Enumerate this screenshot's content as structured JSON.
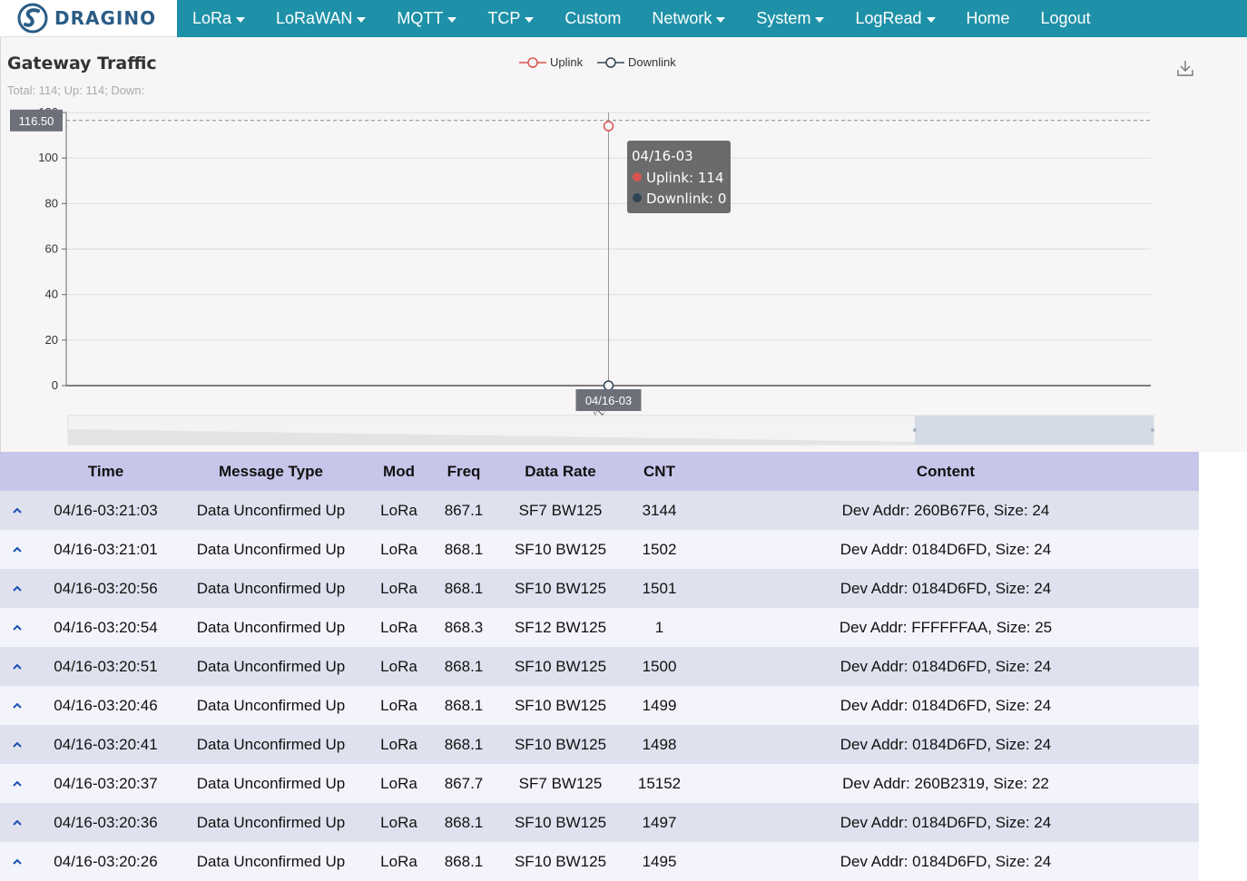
{
  "nav": {
    "brand": "DRAGINO",
    "items": [
      {
        "label": "LoRa",
        "dropdown": true
      },
      {
        "label": "LoRaWAN",
        "dropdown": true
      },
      {
        "label": "MQTT",
        "dropdown": true
      },
      {
        "label": "TCP",
        "dropdown": true
      },
      {
        "label": "Custom",
        "dropdown": false
      },
      {
        "label": "Network",
        "dropdown": true
      },
      {
        "label": "System",
        "dropdown": true
      },
      {
        "label": "LogRead",
        "dropdown": true
      },
      {
        "label": "Home",
        "dropdown": false
      },
      {
        "label": "Logout",
        "dropdown": false
      }
    ]
  },
  "traffic": {
    "title": "Gateway Traffic",
    "summary": "Total: 114; Up: 114; Down:",
    "legend": {
      "uplink": "Uplink",
      "downlink": "Downlink"
    },
    "icons": {
      "download": "download-icon"
    }
  },
  "chart_data": {
    "type": "line",
    "categories": [
      "04/16-03"
    ],
    "series": [
      {
        "name": "Uplink",
        "values": [
          114
        ],
        "color": "#d9534f"
      },
      {
        "name": "Downlink",
        "values": [
          0
        ],
        "color": "#2f4554"
      }
    ],
    "ylim": [
      0,
      120
    ],
    "yticks": [
      0,
      20,
      40,
      60,
      80,
      100,
      120
    ],
    "grid": true,
    "legend": "top-center",
    "crosshair_y_label": "116.50",
    "crosshair_x_label": "04/16-03",
    "tooltip": {
      "title": "04/16-03",
      "uplink": "Uplink: 114",
      "downlink": "Downlink: 0"
    },
    "rotated_x_label": "04/16-03"
  },
  "table": {
    "headers": [
      "Time",
      "Message Type",
      "Mod",
      "Freq",
      "Data Rate",
      "CNT",
      "Content"
    ],
    "rows": [
      [
        "04/16-03:21:03",
        "Data Unconfirmed Up",
        "LoRa",
        "867.1",
        "SF7 BW125",
        "3144",
        "Dev Addr: 260B67F6, Size: 24"
      ],
      [
        "04/16-03:21:01",
        "Data Unconfirmed Up",
        "LoRa",
        "868.1",
        "SF10 BW125",
        "1502",
        "Dev Addr: 0184D6FD, Size: 24"
      ],
      [
        "04/16-03:20:56",
        "Data Unconfirmed Up",
        "LoRa",
        "868.1",
        "SF10 BW125",
        "1501",
        "Dev Addr: 0184D6FD, Size: 24"
      ],
      [
        "04/16-03:20:54",
        "Data Unconfirmed Up",
        "LoRa",
        "868.3",
        "SF12 BW125",
        "1",
        "Dev Addr: FFFFFFAA, Size: 25"
      ],
      [
        "04/16-03:20:51",
        "Data Unconfirmed Up",
        "LoRa",
        "868.1",
        "SF10 BW125",
        "1500",
        "Dev Addr: 0184D6FD, Size: 24"
      ],
      [
        "04/16-03:20:46",
        "Data Unconfirmed Up",
        "LoRa",
        "868.1",
        "SF10 BW125",
        "1499",
        "Dev Addr: 0184D6FD, Size: 24"
      ],
      [
        "04/16-03:20:41",
        "Data Unconfirmed Up",
        "LoRa",
        "868.1",
        "SF10 BW125",
        "1498",
        "Dev Addr: 0184D6FD, Size: 24"
      ],
      [
        "04/16-03:20:37",
        "Data Unconfirmed Up",
        "LoRa",
        "867.7",
        "SF7 BW125",
        "15152",
        "Dev Addr: 260B2319, Size: 22"
      ],
      [
        "04/16-03:20:36",
        "Data Unconfirmed Up",
        "LoRa",
        "868.1",
        "SF10 BW125",
        "1497",
        "Dev Addr: 0184D6FD, Size: 24"
      ],
      [
        "04/16-03:20:26",
        "Data Unconfirmed Up",
        "LoRa",
        "868.1",
        "SF10 BW125",
        "1495",
        "Dev Addr: 0184D6FD, Size: 24"
      ]
    ]
  }
}
